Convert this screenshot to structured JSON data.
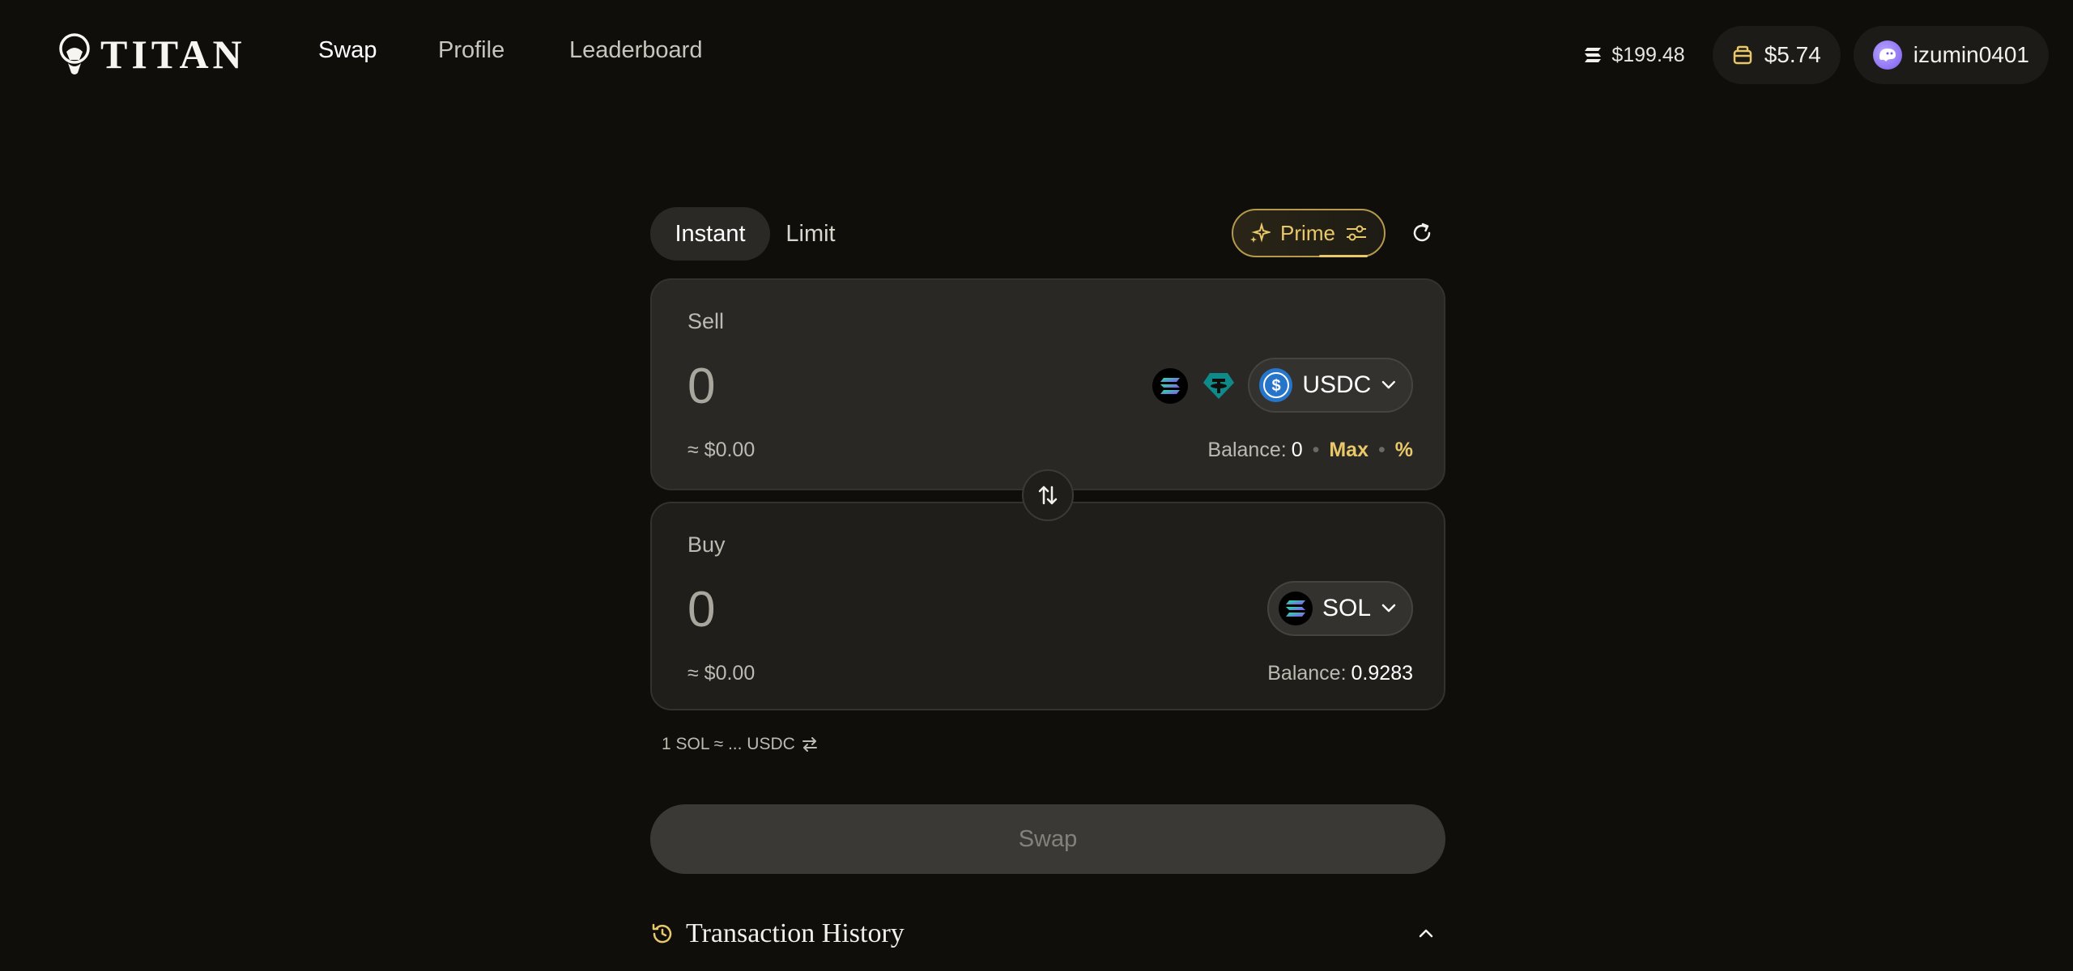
{
  "brand": {
    "name": "TITAN"
  },
  "nav": {
    "items": [
      {
        "label": "Swap",
        "active": true
      },
      {
        "label": "Profile",
        "active": false
      },
      {
        "label": "Leaderboard",
        "active": false
      }
    ]
  },
  "header": {
    "sol_price": "$199.48",
    "wallet_balance": "$5.74",
    "username": "izumin0401"
  },
  "swap": {
    "tabs": [
      {
        "label": "Instant",
        "active": true
      },
      {
        "label": "Limit",
        "active": false
      }
    ],
    "prime_label": "Prime",
    "sell": {
      "label": "Sell",
      "amount": "0",
      "usd": "≈ $0.00",
      "token": "USDC",
      "balance_label": "Balance:",
      "balance": "0",
      "max_label": "Max",
      "percent_label": "%"
    },
    "buy": {
      "label": "Buy",
      "amount": "0",
      "usd": "≈ $0.00",
      "token": "SOL",
      "balance_label": "Balance:",
      "balance": "0.9283"
    },
    "rate": "1 SOL ≈ ... USDC",
    "swap_button": "Swap",
    "history_title": "Transaction History"
  },
  "colors": {
    "background": "#0f0e0b",
    "accent_gold": "#e9c86a",
    "usdc_blue": "#2775ca",
    "usdt_teal": "#26a17b"
  },
  "icons": {
    "sol": "solana-icon",
    "usdc": "usdc-icon",
    "usdt": "tether-icon",
    "wallet": "wallet-icon",
    "refresh": "refresh-icon",
    "switch": "swap-arrows-icon",
    "history": "history-clock-icon"
  }
}
